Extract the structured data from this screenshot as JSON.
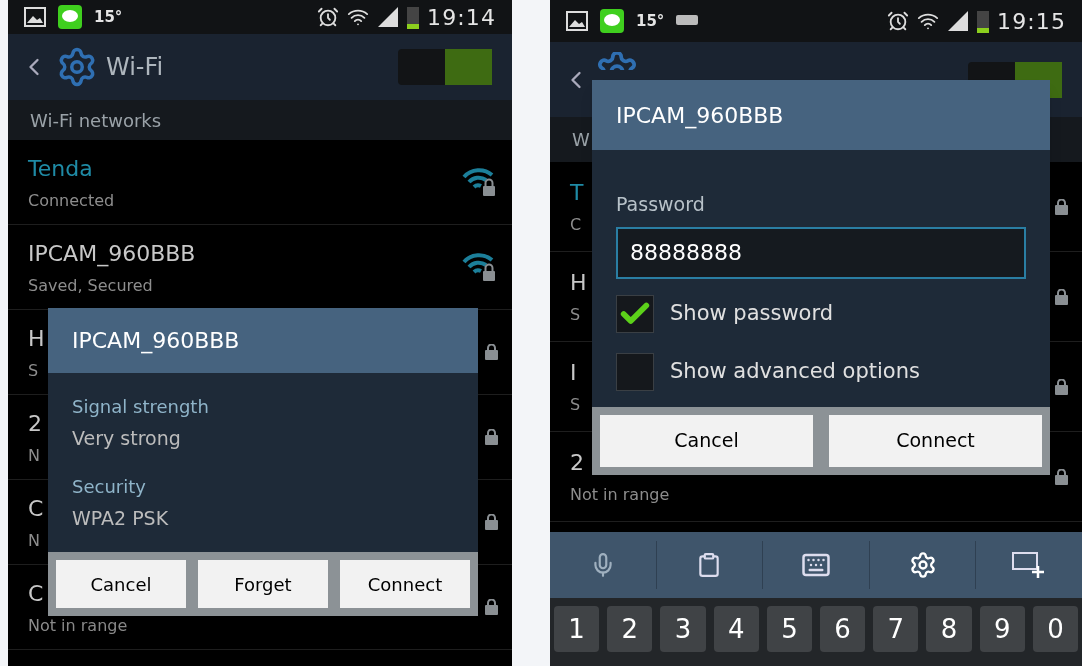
{
  "left_phone": {
    "status_bar": {
      "temperature": "15°",
      "time": "19:14"
    },
    "action_bar": {
      "title": "Wi-Fi",
      "wifi_on": true
    },
    "section": "Wi-Fi networks",
    "networks": [
      {
        "name": "Tenda",
        "status": "Connected",
        "connected": true
      },
      {
        "name": "IPCAM_960BBB",
        "status": "Saved, Secured",
        "connected": false
      },
      {
        "name": "H",
        "status": "S",
        "connected": false
      },
      {
        "name": "2",
        "status": "N",
        "connected": false
      },
      {
        "name": "C",
        "status": "N",
        "connected": false
      },
      {
        "name": "C",
        "status": "Not in range",
        "connected": false
      }
    ],
    "dialog": {
      "title": "IPCAM_960BBB",
      "details": [
        {
          "label": "Signal strength",
          "value": "Very strong"
        },
        {
          "label": "Security",
          "value": "WPA2 PSK"
        }
      ],
      "buttons": [
        "Cancel",
        "Forget",
        "Connect"
      ]
    }
  },
  "right_phone": {
    "status_bar": {
      "temperature": "15°",
      "time": "19:15"
    },
    "action_bar": {
      "wifi_on": true
    },
    "section": "W",
    "networks": [
      {
        "name": "T",
        "status": "C",
        "connected": true
      },
      {
        "name": "H",
        "status": "S",
        "connected": false
      },
      {
        "name": "I",
        "status": "S",
        "connected": false
      },
      {
        "name": "2",
        "status": "Not in range",
        "connected": false
      }
    ],
    "dialog": {
      "title": "IPCAM_960BBB",
      "password_label": "Password",
      "password": "88888888",
      "options": [
        {
          "label": "Show password",
          "checked": true
        },
        {
          "label": "Show advanced options",
          "checked": false
        }
      ],
      "buttons": [
        "Cancel",
        "Connect"
      ]
    },
    "keyboard": {
      "keys": [
        "1",
        "2",
        "3",
        "4",
        "5",
        "6",
        "7",
        "8",
        "9",
        "0"
      ]
    }
  }
}
